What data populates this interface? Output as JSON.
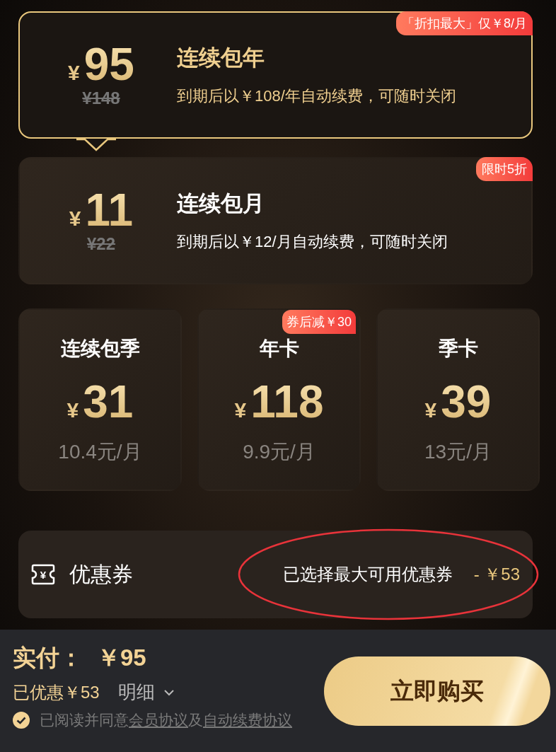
{
  "plans": [
    {
      "kind": "wide",
      "selected": true,
      "currency": "¥",
      "amount": "95",
      "original_price": "¥148",
      "name": "连续包年",
      "desc": "到期后以￥108/年自动续费，可随时关闭",
      "badge": "「折扣最大」仅￥8/月"
    },
    {
      "kind": "wide",
      "selected": false,
      "currency": "¥",
      "amount": "11",
      "original_price": "¥22",
      "name": "连续包月",
      "desc": "到期后以￥12/月自动续费，可随时关闭",
      "badge": "限时5折"
    },
    {
      "kind": "small",
      "selected": false,
      "name": "连续包季",
      "currency": "¥",
      "amount": "31",
      "per_month": "10.4元/月"
    },
    {
      "kind": "small",
      "selected": false,
      "name": "年卡",
      "currency": "¥",
      "amount": "118",
      "per_month": "9.9元/月",
      "badge": "券后减￥30"
    },
    {
      "kind": "small",
      "selected": false,
      "name": "季卡",
      "currency": "¥",
      "amount": "39",
      "per_month": "13元/月"
    }
  ],
  "coupon": {
    "icon_glyph": "¥",
    "label": "优惠券",
    "status": "已选择最大可用优惠券",
    "discount": "- ￥53",
    "highlight": {
      "kind": "ellipse"
    }
  },
  "footer": {
    "pay_label": "实付：",
    "pay_amount": "￥95",
    "saved": "已优惠￥53",
    "detail": "明细",
    "agreement": {
      "checked": true,
      "parts": [
        {
          "kind": "text",
          "text": "已阅读并同意"
        },
        {
          "kind": "link",
          "text": "会员协议"
        },
        {
          "kind": "text",
          "text": "及"
        },
        {
          "kind": "link",
          "text": "自动续费协议"
        }
      ]
    },
    "buy_button": "立即购买"
  }
}
